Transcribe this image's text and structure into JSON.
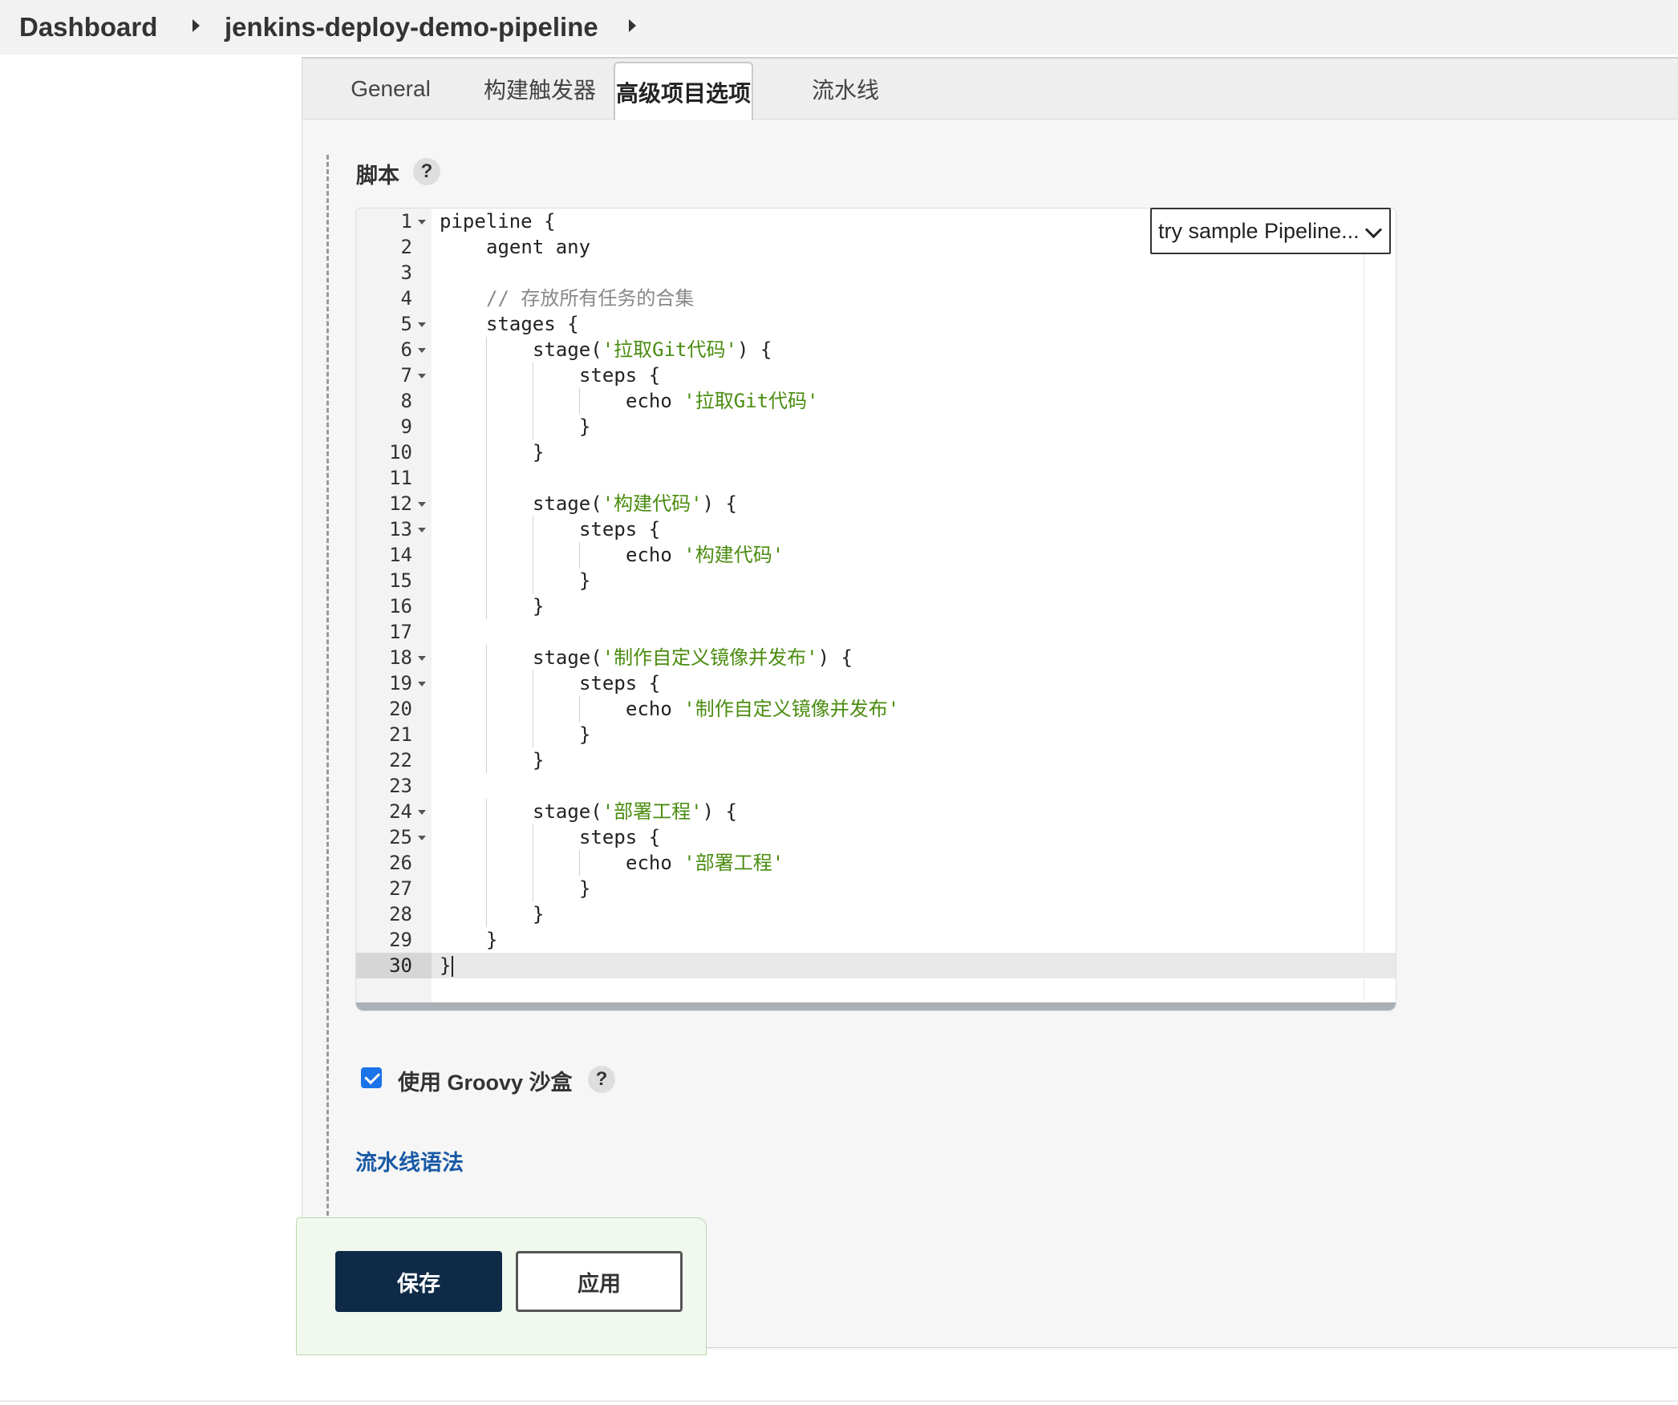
{
  "breadcrumb": {
    "items": [
      "Dashboard",
      "jenkins-deploy-demo-pipeline"
    ]
  },
  "tabs": [
    "General",
    "构建触发器",
    "高级项目选项",
    "流水线"
  ],
  "active_tab": "高级项目选项",
  "script_section": {
    "label": "脚本",
    "help": "?",
    "sample_select": "try sample Pipeline...",
    "line_numbers": [
      "1",
      "2",
      "3",
      "4",
      "5",
      "6",
      "7",
      "8",
      "9",
      "10",
      "11",
      "12",
      "13",
      "14",
      "15",
      "16",
      "17",
      "18",
      "19",
      "20",
      "21",
      "22",
      "23",
      "24",
      "25",
      "26",
      "27",
      "28",
      "29",
      "30"
    ],
    "code": {
      "l1": "pipeline {",
      "l2": "agent any",
      "l4": "// 存放所有任务的合集",
      "l5": "stages {",
      "l6a": "stage(",
      "l6s": "'拉取Git代码'",
      "l6b": ") {",
      "l7": "steps {",
      "l8a": "echo ",
      "l8s": "'拉取Git代码'",
      "l9": "}",
      "l10": "}",
      "l12a": "stage(",
      "l12s": "'构建代码'",
      "l12b": ") {",
      "l13": "steps {",
      "l14a": "echo ",
      "l14s": "'构建代码'",
      "l15": "}",
      "l16": "}",
      "l18a": "stage(",
      "l18s": "'制作自定义镜像并发布'",
      "l18b": ") {",
      "l19": "steps {",
      "l20a": "echo ",
      "l20s": "'制作自定义镜像并发布'",
      "l21": "}",
      "l22": "}",
      "l24a": "stage(",
      "l24s": "'部署工程'",
      "l24b": ") {",
      "l25": "steps {",
      "l26a": "echo ",
      "l26s": "'部署工程'",
      "l27": "}",
      "l28": "}",
      "l29": "}",
      "l30": "}"
    }
  },
  "sandbox": {
    "checked": true,
    "label": "使用 Groovy 沙盒",
    "help": "?"
  },
  "syntax_link": "流水线语法",
  "buttons": {
    "save": "保存",
    "apply": "应用"
  },
  "colors": {
    "primary_button": "#0e2a47",
    "link": "#1a5aa6",
    "string": "#4a8c0f",
    "checkbox": "#1a73e8"
  }
}
